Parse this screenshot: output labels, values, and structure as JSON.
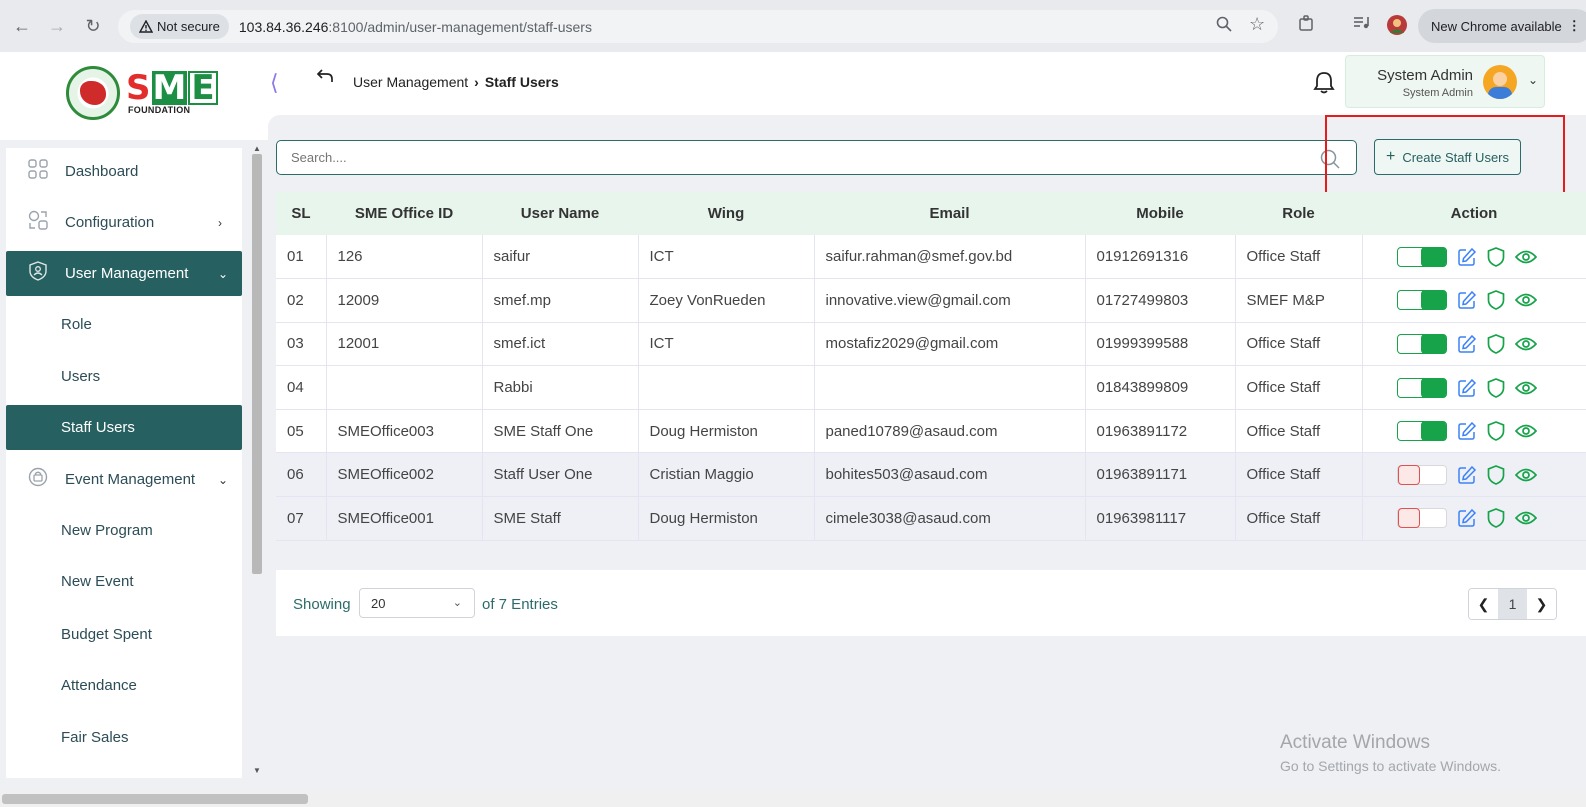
{
  "browser": {
    "not_secure": "Not secure",
    "url_host": "103.84.36.246",
    "url_rest": ":8100/admin/user-management/staff-users",
    "chrome_available": "New Chrome available"
  },
  "header": {
    "logo_text": "SME",
    "logo_sub": "FOUNDATION",
    "breadcrumb": [
      "User Management",
      "Staff Users"
    ],
    "user_name": "System Admin",
    "user_role": "System Admin"
  },
  "sidebar": {
    "items": [
      {
        "label": "Dashboard",
        "icon": "grid-icon"
      },
      {
        "label": "Configuration",
        "icon": "config-icon"
      },
      {
        "label": "User Management",
        "icon": "user-shield-icon"
      },
      {
        "label": "Role"
      },
      {
        "label": "Users"
      },
      {
        "label": "Staff Users"
      },
      {
        "label": "Event Management",
        "icon": "event-icon"
      },
      {
        "label": "New Program"
      },
      {
        "label": "New Event"
      },
      {
        "label": "Budget Spent"
      },
      {
        "label": "Attendance"
      },
      {
        "label": "Fair Sales"
      }
    ]
  },
  "search": {
    "placeholder": "Search...."
  },
  "create_button": "Create Staff Users",
  "table": {
    "headers": [
      "SL",
      "SME Office ID",
      "User Name",
      "Wing",
      "Email",
      "Mobile",
      "Role",
      "Action"
    ],
    "rows": [
      {
        "sl": "01",
        "office_id": "126",
        "user": "saifur",
        "wing": "ICT",
        "email": "saifur.rahman@smef.gov.bd",
        "mobile": "01912691316",
        "role": "Office Staff",
        "active": true
      },
      {
        "sl": "02",
        "office_id": "12009",
        "user": "smef.mp",
        "wing": "Zoey VonRueden",
        "email": "innovative.view@gmail.com",
        "mobile": "01727499803",
        "role": "SMEF M&P",
        "active": true
      },
      {
        "sl": "03",
        "office_id": "12001",
        "user": "smef.ict",
        "wing": "ICT",
        "email": "mostafiz2029@gmail.com",
        "mobile": "01999399588",
        "role": "Office Staff",
        "active": true
      },
      {
        "sl": "04",
        "office_id": "",
        "user": "Rabbi",
        "wing": "",
        "email": "",
        "mobile": "01843899809",
        "role": "Office Staff",
        "active": true
      },
      {
        "sl": "05",
        "office_id": "SMEOffice003",
        "user": "SME Staff One",
        "wing": "Doug Hermiston",
        "email": "paned10789@asaud.com",
        "mobile": "01963891172",
        "role": "Office Staff",
        "active": true
      },
      {
        "sl": "06",
        "office_id": "SMEOffice002",
        "user": "Staff User One",
        "wing": "Cristian Maggio",
        "email": "bohites503@asaud.com",
        "mobile": "01963891171",
        "role": "Office Staff",
        "active": false
      },
      {
        "sl": "07",
        "office_id": "SMEOffice001",
        "user": "SME Staff",
        "wing": "Doug Hermiston",
        "email": "cimele3038@asaud.com",
        "mobile": "01963981117",
        "role": "Office Staff",
        "active": false
      }
    ]
  },
  "pagination": {
    "showing": "Showing",
    "page_size": "20",
    "entries": "of 7 Entries",
    "current_page": "1"
  },
  "watermark": {
    "title": "Activate Windows",
    "subtitle": "Go to Settings to activate Windows."
  },
  "colors": {
    "primary": "#276060",
    "toggle_on": "#16a34a",
    "toggle_off": "#e05252",
    "highlight": "#e51c1c"
  }
}
